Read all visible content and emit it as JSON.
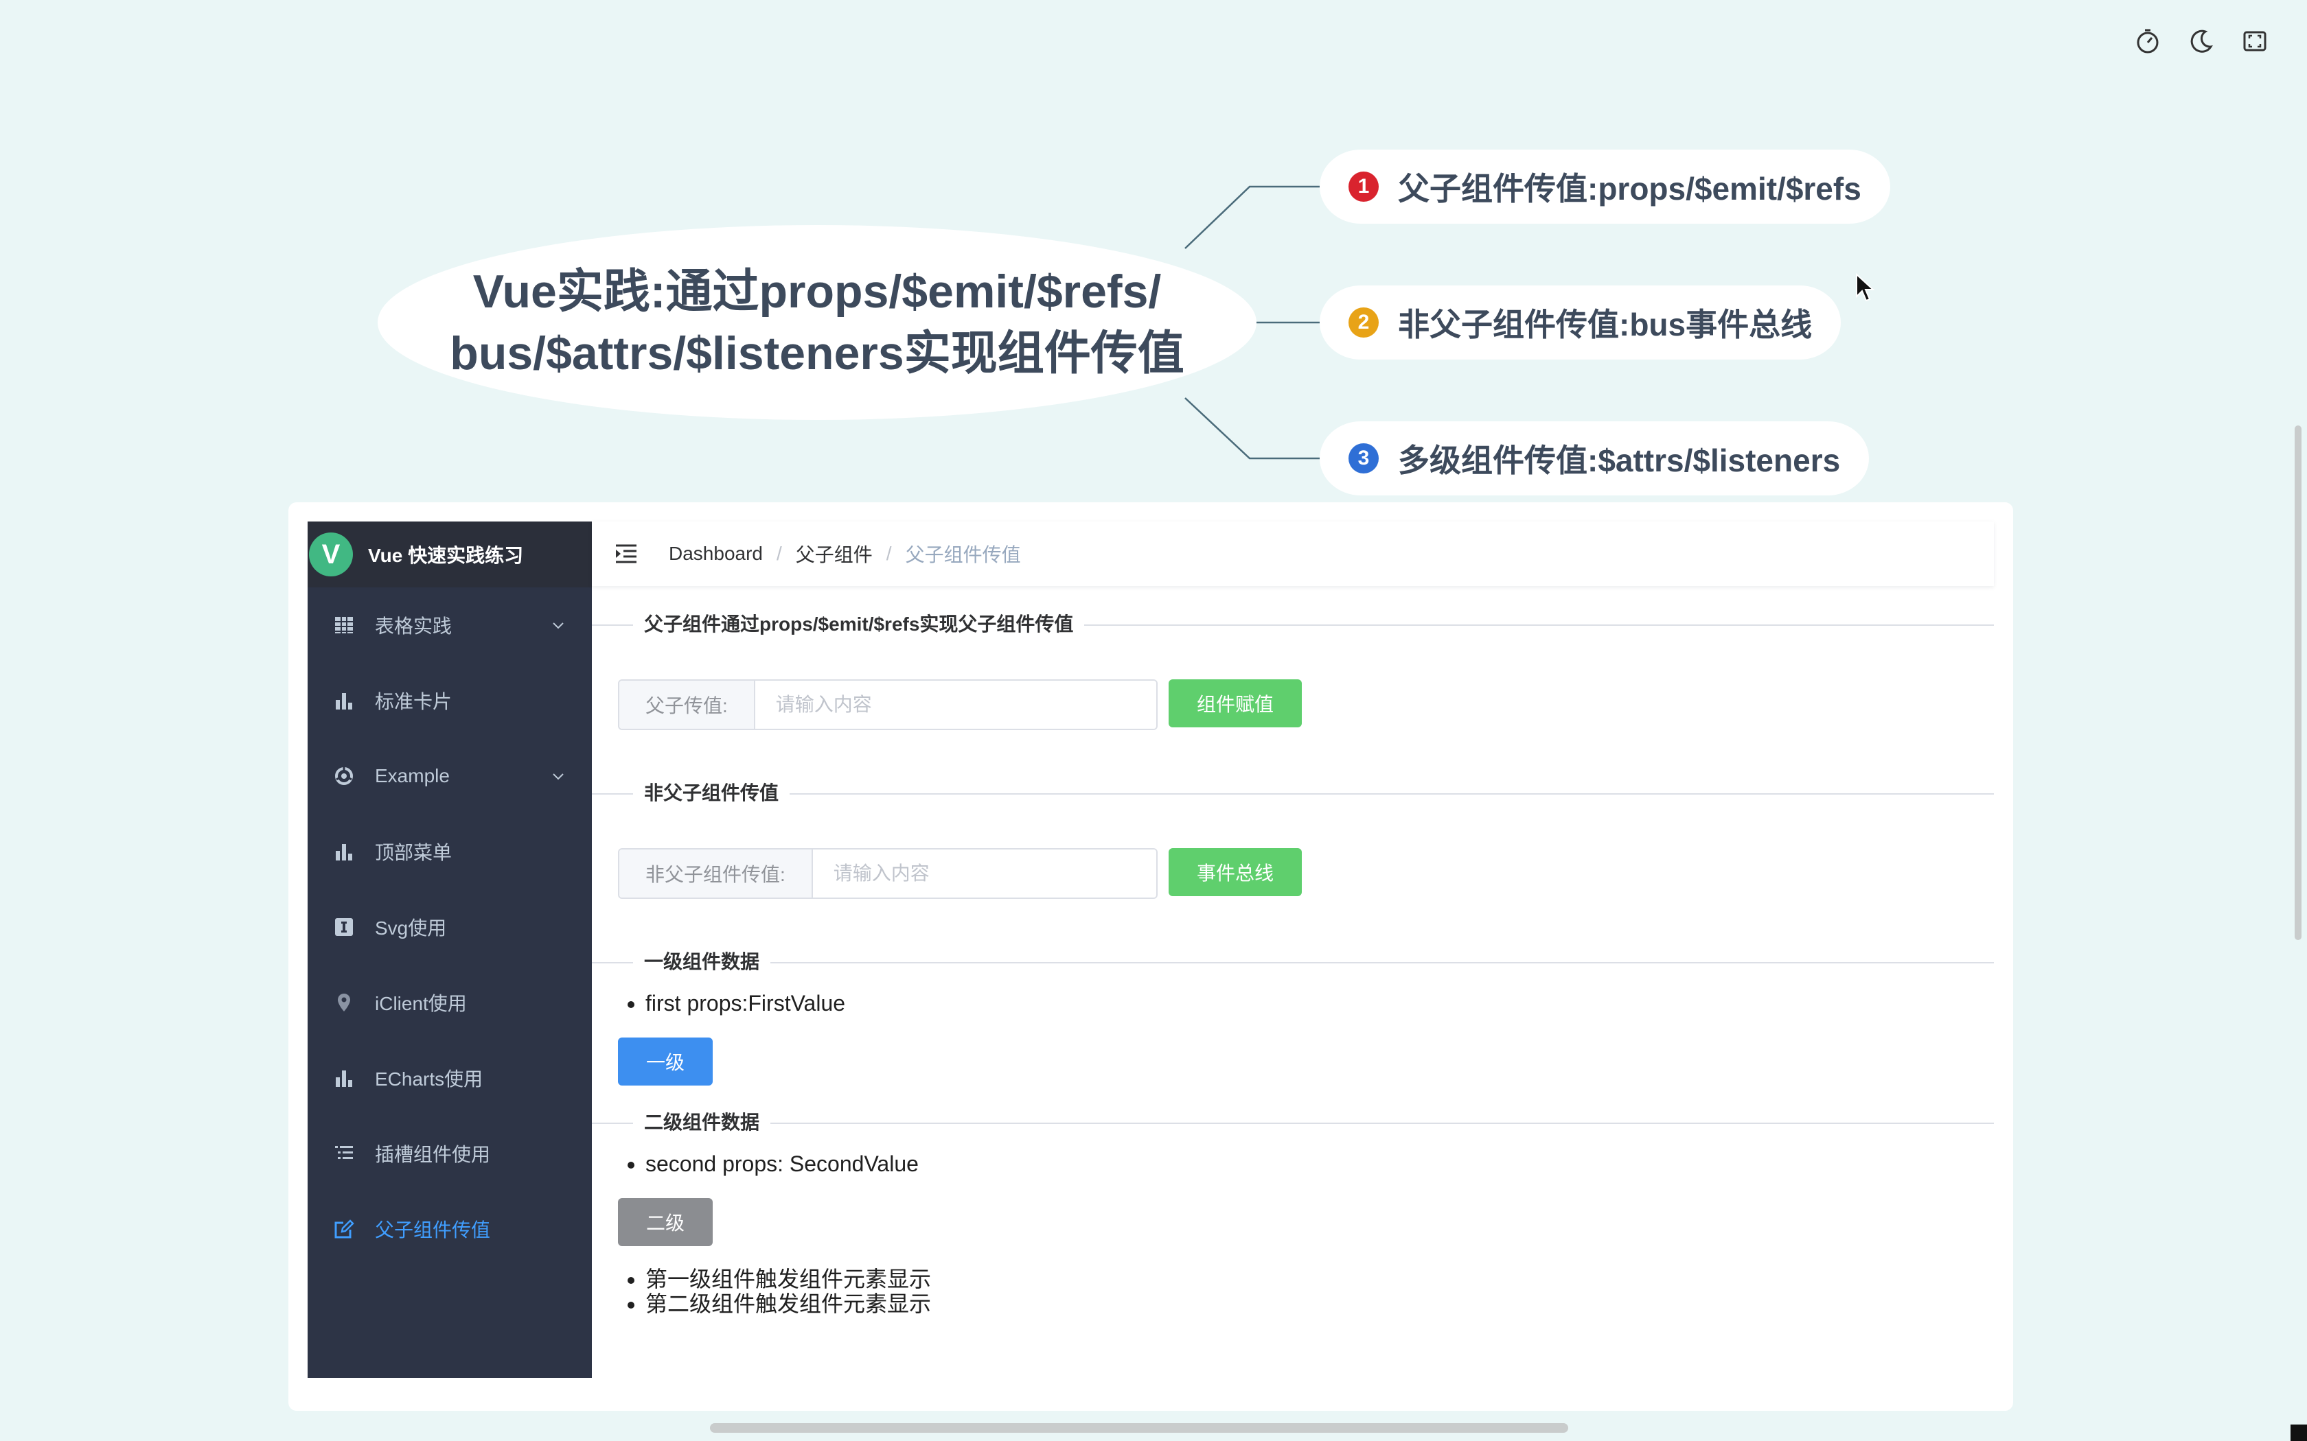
{
  "toolbar": {
    "icons": [
      "timer-icon",
      "moon-icon",
      "fullscreen-icon"
    ]
  },
  "mindmap": {
    "central_line1": "Vue实践:通过props/$emit/$refs/",
    "central_line2": "bus/$attrs/$listeners实现组件传值",
    "branches": [
      {
        "num": "1",
        "text": "父子组件传值:props/$emit/$refs",
        "color": "#d9232e"
      },
      {
        "num": "2",
        "text": "非父子组件传值:bus事件总线",
        "color": "#e8a317"
      },
      {
        "num": "3",
        "text": "多级组件传值:$attrs/$listeners",
        "color": "#2f6fd6"
      }
    ]
  },
  "sidebar": {
    "logo_letter": "V",
    "title": "Vue 快速实践练习",
    "items": [
      {
        "label": "表格实践",
        "icon": "table-icon",
        "has_submenu": true
      },
      {
        "label": "标准卡片",
        "icon": "bar-chart-icon",
        "has_submenu": false
      },
      {
        "label": "Example",
        "icon": "example-icon",
        "has_submenu": true
      },
      {
        "label": "顶部菜单",
        "icon": "bar-chart-icon",
        "has_submenu": false
      },
      {
        "label": "Svg使用",
        "icon": "svg-icon",
        "has_submenu": false
      },
      {
        "label": "iClient使用",
        "icon": "location-pin-icon",
        "has_submenu": false
      },
      {
        "label": "ECharts使用",
        "icon": "bar-chart-icon",
        "has_submenu": false
      },
      {
        "label": "插槽组件使用",
        "icon": "list-icon",
        "has_submenu": false
      },
      {
        "label": "父子组件传值",
        "icon": "edit-icon",
        "has_submenu": false,
        "active": true
      }
    ]
  },
  "breadcrumb": [
    "Dashboard",
    "父子组件",
    "父子组件传值"
  ],
  "sections": {
    "s1_title": "父子组件通过props/$emit/$refs实现父子组件传值",
    "s1_label": "父子传值:",
    "s1_placeholder": "请输入内容",
    "s1_button": "组件赋值",
    "s2_title": "非父子组件传值",
    "s2_label": "非父子组件传值:",
    "s2_placeholder": "请输入内容",
    "s2_button": "事件总线",
    "s3_title": "一级组件数据",
    "s3_item": "first props:FirstValue",
    "s3_button": "一级",
    "s4_title": "二级组件数据",
    "s4_item": "second props: SecondValue",
    "s4_button": "二级",
    "result_items": [
      "第一级组件触发组件元素显示",
      "第二级组件触发组件元素显示"
    ]
  },
  "colors": {
    "background": "#eaf6f6",
    "sidebar": "#2d3446",
    "active": "#409eff",
    "success": "#5fcf6d",
    "primary": "#3d8ff0"
  }
}
